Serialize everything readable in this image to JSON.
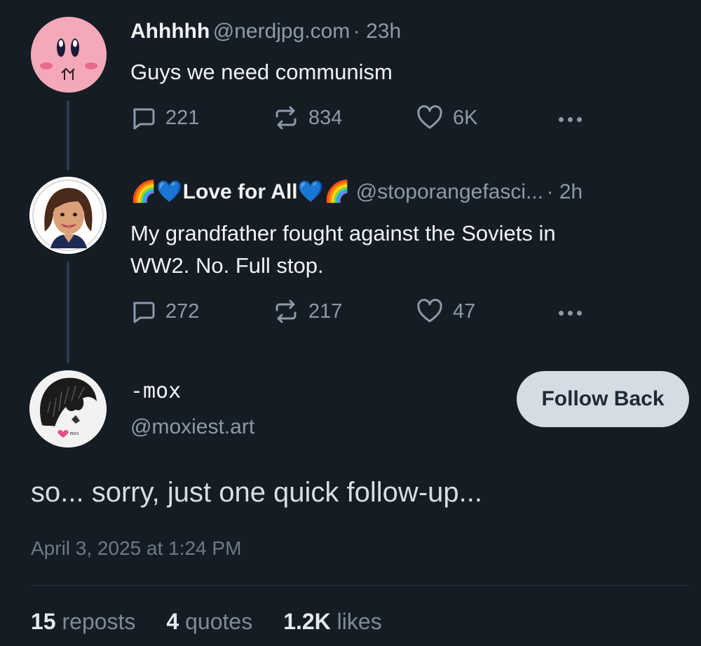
{
  "posts": [
    {
      "name": "Ahhhhh",
      "handle": "@nerdjpg.com",
      "time": "· 23h",
      "text": "Guys we need communism",
      "replies": "221",
      "reposts": "834",
      "likes": "6K",
      "avatar_icon": "pink-blob-character-avatar"
    },
    {
      "name": "🌈💙Love for All💙🌈",
      "handle": "@stoporangefasci...",
      "time": "· 2h",
      "text_line1": "My grandfather fought against the Soviets in",
      "text_line2": "WW2. No. Full stop.",
      "replies": "272",
      "reposts": "217",
      "likes": "47",
      "avatar_icon": "cartoon-woman-avatar"
    }
  ],
  "main_post": {
    "display_name": "-mox",
    "handle": "@moxiest.art",
    "follow_label": "Follow Back",
    "text": "so... sorry, just one quick follow-up...",
    "timestamp": "April 3, 2025 at 1:24 PM",
    "reposts_count": "15",
    "reposts_label": " reposts",
    "quotes_count": "4",
    "quotes_label": " quotes",
    "likes_count": "1.2K",
    "likes_label": " likes",
    "avatar_icon": "sketch-hair-avatar"
  },
  "colors": {
    "background": "#151c24",
    "muted": "#8d9aa7",
    "button_bg": "#d5dce4"
  }
}
